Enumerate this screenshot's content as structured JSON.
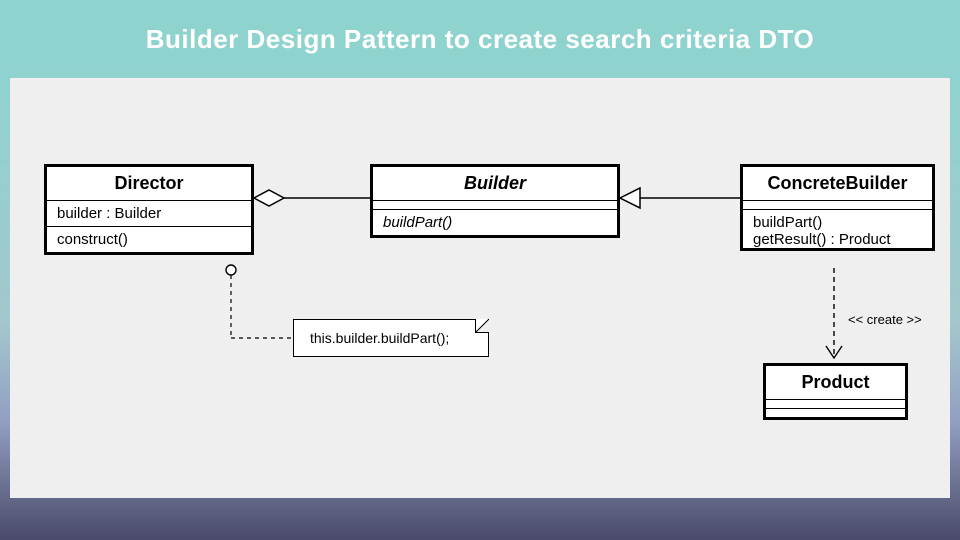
{
  "title": "Builder Design Pattern to create search criteria DTO",
  "classes": {
    "director": {
      "name": "Director",
      "attrs": "builder : Builder",
      "ops": "construct()"
    },
    "builder": {
      "name": "Builder",
      "ops": "buildPart()"
    },
    "concrete": {
      "name": "ConcreteBuilder",
      "ops1": "buildPart()",
      "ops2": "getResult() : Product"
    },
    "product": {
      "name": "Product"
    }
  },
  "note": "this.builder.buildPart();",
  "create_label": "<< create >>"
}
